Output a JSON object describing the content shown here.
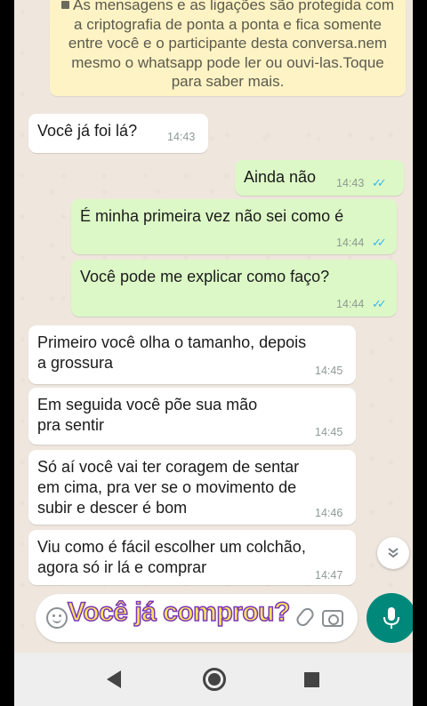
{
  "encryption_notice": {
    "text": "As mensagens e as ligações são protegida com a criptografia de ponta a ponta e fica somente entre você e o participante desta conversa.nem mesmo o whatsapp pode ler ou ouvi-las.Toque para saber mais."
  },
  "messages": [
    {
      "direction": "in",
      "text": "Você já foi lá?",
      "time": "14:43"
    },
    {
      "direction": "out",
      "text": "Ainda não",
      "time": "14:43",
      "ticks": "✓✓"
    },
    {
      "direction": "out",
      "text": "É minha primeira vez não sei como é",
      "time": "14:44",
      "ticks": "✓✓"
    },
    {
      "direction": "out",
      "text": "Você pode me explicar como faço?",
      "time": "14:44",
      "ticks": "✓✓"
    },
    {
      "direction": "in",
      "text": "Primeiro você olha o tamanho, depois a grossura",
      "time": "14:45"
    },
    {
      "direction": "in",
      "text": "Em seguida você põe sua mão pra sentir",
      "time": "14:45"
    },
    {
      "direction": "in",
      "text": "Só aí você vai ter coragem de sentar em cima, pra ver se o movimento de subir e descer é bom",
      "time": "14:46"
    },
    {
      "direction": "in",
      "text": "Viu como é fácil escolher um colchão, agora só ir lá e comprar",
      "time": "14:47"
    }
  ],
  "input": {
    "caption": "Você já comprou?"
  },
  "colors": {
    "chat_bg": "#efe7de",
    "incoming": "#ffffff",
    "outgoing": "#dcf8c6",
    "read_ticks": "#34b7f1",
    "mic_button": "#00897b",
    "caption_fill": "#ffe45c",
    "caption_outline": "#7a36b8"
  },
  "icons": {
    "lock": "lock-icon",
    "scroll_down": "chevron-down-icon",
    "emoji": "emoji-icon",
    "attach": "paperclip-icon",
    "camera": "camera-icon",
    "mic": "microphone-icon",
    "nav_back": "back-icon",
    "nav_home": "home-icon",
    "nav_recent": "recent-apps-icon"
  }
}
